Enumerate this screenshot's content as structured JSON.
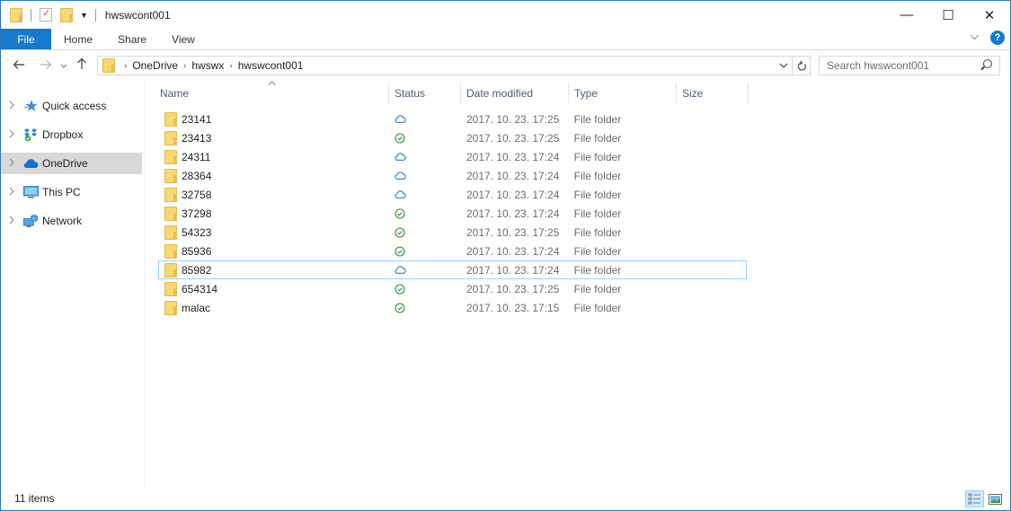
{
  "window": {
    "title": "hwswcont001",
    "controls": {
      "minimize": "—",
      "maximize": "☐",
      "close": "✕"
    }
  },
  "quick_access_toolbar": {
    "icons": [
      "folder-icon",
      "properties-icon",
      "new-folder-icon",
      "customize-dropdown-icon"
    ]
  },
  "ribbon": {
    "tabs": [
      {
        "label": "File",
        "active": true
      },
      {
        "label": "Home"
      },
      {
        "label": "Share"
      },
      {
        "label": "View"
      }
    ],
    "help_label": "?"
  },
  "navigation": {
    "breadcrumb": [
      "OneDrive",
      "hwswx",
      "hwswcont001"
    ],
    "search_placeholder": "Search hwswcont001"
  },
  "sidebar": {
    "items": [
      {
        "label": "Quick access",
        "icon": "star-icon",
        "selected": false
      },
      {
        "label": "Dropbox",
        "icon": "dropbox-icon",
        "selected": false
      },
      {
        "label": "OneDrive",
        "icon": "onedrive-cloud-icon",
        "selected": true
      },
      {
        "label": "This PC",
        "icon": "computer-icon",
        "selected": false
      },
      {
        "label": "Network",
        "icon": "network-icon",
        "selected": false
      }
    ]
  },
  "file_list": {
    "columns": [
      "Name",
      "Status",
      "Date modified",
      "Type",
      "Size"
    ],
    "sorted_by": "Name",
    "rows": [
      {
        "name": "23141",
        "status": "online-only",
        "date": "2017. 10. 23. 17:25",
        "type": "File folder",
        "size": ""
      },
      {
        "name": "23413",
        "status": "synced",
        "date": "2017. 10. 23. 17:25",
        "type": "File folder",
        "size": ""
      },
      {
        "name": "24311",
        "status": "online-only",
        "date": "2017. 10. 23. 17:24",
        "type": "File folder",
        "size": ""
      },
      {
        "name": "28364",
        "status": "online-only",
        "date": "2017. 10. 23. 17:24",
        "type": "File folder",
        "size": ""
      },
      {
        "name": "32758",
        "status": "online-only",
        "date": "2017. 10. 23. 17:24",
        "type": "File folder",
        "size": ""
      },
      {
        "name": "37298",
        "status": "synced",
        "date": "2017. 10. 23. 17:24",
        "type": "File folder",
        "size": ""
      },
      {
        "name": "54323",
        "status": "synced",
        "date": "2017. 10. 23. 17:25",
        "type": "File folder",
        "size": ""
      },
      {
        "name": "85936",
        "status": "synced",
        "date": "2017. 10. 23. 17:24",
        "type": "File folder",
        "size": ""
      },
      {
        "name": "85982",
        "status": "online-only",
        "date": "2017. 10. 23. 17:24",
        "type": "File folder",
        "size": "",
        "focused": true
      },
      {
        "name": "654314",
        "status": "synced",
        "date": "2017. 10. 23. 17:25",
        "type": "File folder",
        "size": ""
      },
      {
        "name": "malac",
        "status": "synced",
        "date": "2017. 10. 23. 17:15",
        "type": "File folder",
        "size": ""
      }
    ]
  },
  "status_bar": {
    "item_count": "11 items",
    "view_modes": [
      {
        "name": "details-view",
        "active": true
      },
      {
        "name": "large-icons-view",
        "active": false
      }
    ]
  },
  "colors": {
    "accent": "#1979ca",
    "window_border": "#2b79b8",
    "cloud_status": "#2a7ab8",
    "synced_status": "#2e8b3e",
    "header_text": "#4c607a",
    "selection_border": "#99d1ff",
    "nav_selected": "#d9d9d9"
  }
}
